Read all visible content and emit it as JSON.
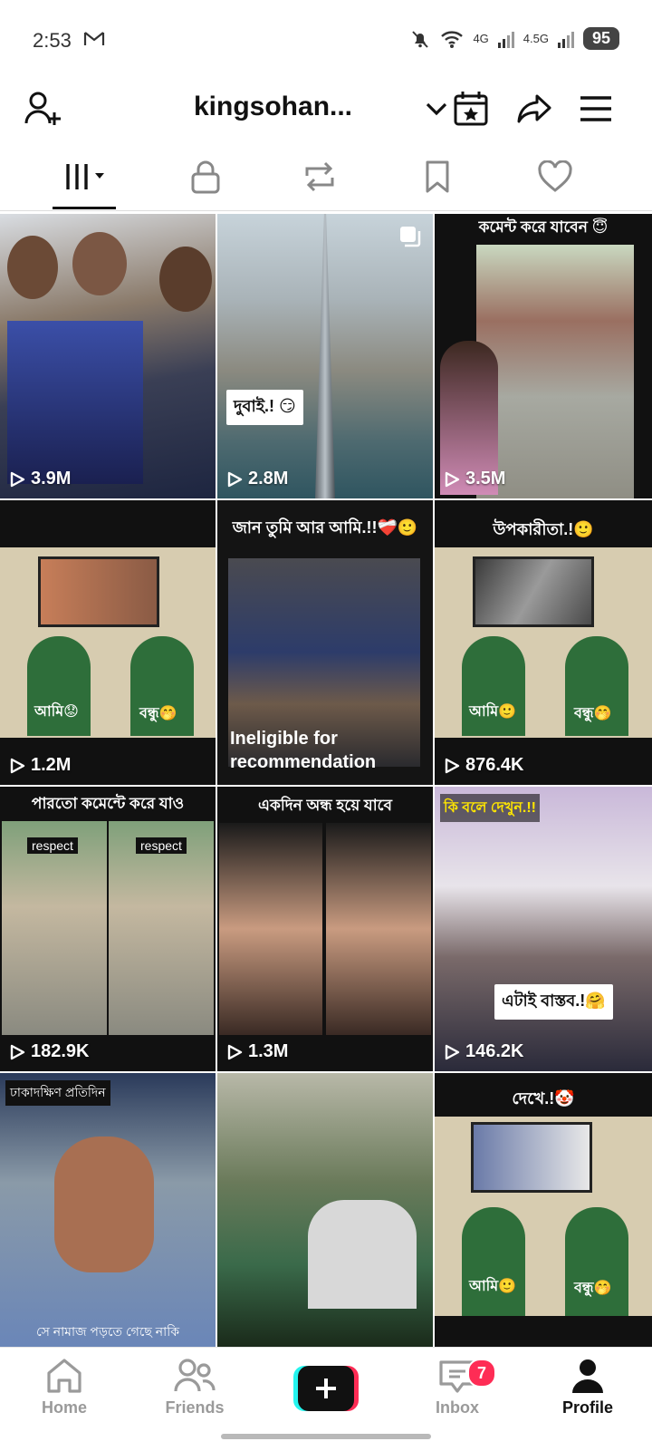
{
  "status": {
    "time": "2:53",
    "network_1": "4G",
    "network_2": "4.5G",
    "battery": "95"
  },
  "header": {
    "username": "king‍sohan..."
  },
  "videos": [
    {
      "views": "3.9M"
    },
    {
      "views": "2.8M",
      "sticker": "দুবাই.! 😏"
    },
    {
      "views": "3.5M",
      "caption_top": "কমেন্ট করে যাবেন 😇"
    },
    {
      "views": "1.2M",
      "label_left": "আমি😟",
      "label_right": "বন্ধু🤭"
    },
    {
      "ineligible": "Ineligible for recommendation",
      "caption_top": "জান তুমি আর আমি.!!❤️‍🩹🙂"
    },
    {
      "views": "876.4K",
      "caption_top": "উপকারীতা.!🙂",
      "label_left": "আমি🙂",
      "label_right": "বন্ধু🤭"
    },
    {
      "views": "182.9K",
      "caption_top": "পারতো কমেন্টে করে যাও",
      "badge_left": "respect",
      "badge_right": "respect"
    },
    {
      "views": "1.3M",
      "caption_top": "একদিন অন্ধ হয়ে যাবে"
    },
    {
      "views": "146.2K",
      "caption_top": "কি বলে দেখুন.!!",
      "sticker": "এটাই বাস্তব.!🤗"
    },
    {
      "caption_top": "ঢাকাদক্ষিণ প্রতিদিন",
      "caption_bottom": "সে নামাজ পড়তে গেছে নাকি"
    },
    {},
    {
      "caption_top": "দেখে.!🤡",
      "label_left": "আমি🙂",
      "label_right": "বন্ধু🤭"
    }
  ],
  "nav": {
    "home": "Home",
    "friends": "Friends",
    "inbox": "Inbox",
    "inbox_badge": "7",
    "profile": "Profile"
  }
}
